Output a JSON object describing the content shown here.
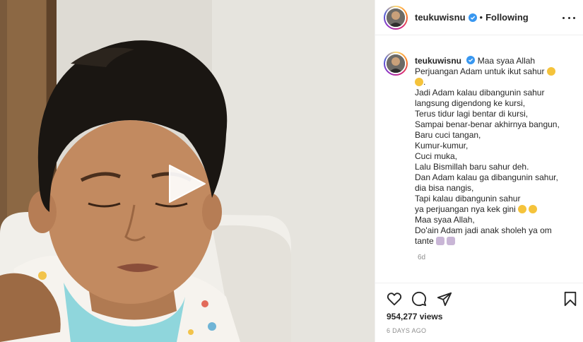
{
  "post": {
    "username": "teukuwisnu",
    "separator": "•",
    "follow_status": "Following",
    "caption_lines": [
      "Maa syaa Allah",
      "Perjuangan Adam untuk ikut sahur",
      ".",
      "Jadi Adam kalau dibangunin sahur",
      "langsung digendong ke kursi,",
      "Terus tidur lagi bentar di kursi,",
      "Sampai benar-benar akhirnya bangun,",
      "Baru cuci tangan,",
      "Kumur-kumur,",
      "Cuci muka,",
      "Lalu Bismillah baru sahur deh.",
      "Dan Adam kalau ga dibangunin sahur,",
      "dia bisa nangis,",
      "Tapi kalau dibangunin sahur",
      "ya perjuangan nya kek gini",
      "Maa syaa Allah,",
      "Do'ain Adam jadi anak sholeh ya om",
      "tante"
    ],
    "time_ago": "6d",
    "views": "954,277 views",
    "date": "6 DAYS AGO"
  },
  "icons": {
    "play": "play-icon",
    "verified": "verified-badge-icon",
    "like": "heart-icon",
    "comment": "comment-icon",
    "share": "share-icon",
    "save": "bookmark-icon",
    "more": "more-options-icon",
    "emoji_grin": "grinning-sweat-emoji",
    "emoji_pray": "folded-hands-emoji"
  },
  "colors": {
    "verified": "#3897f0",
    "muted": "#8e8e8e",
    "text": "#262626"
  }
}
